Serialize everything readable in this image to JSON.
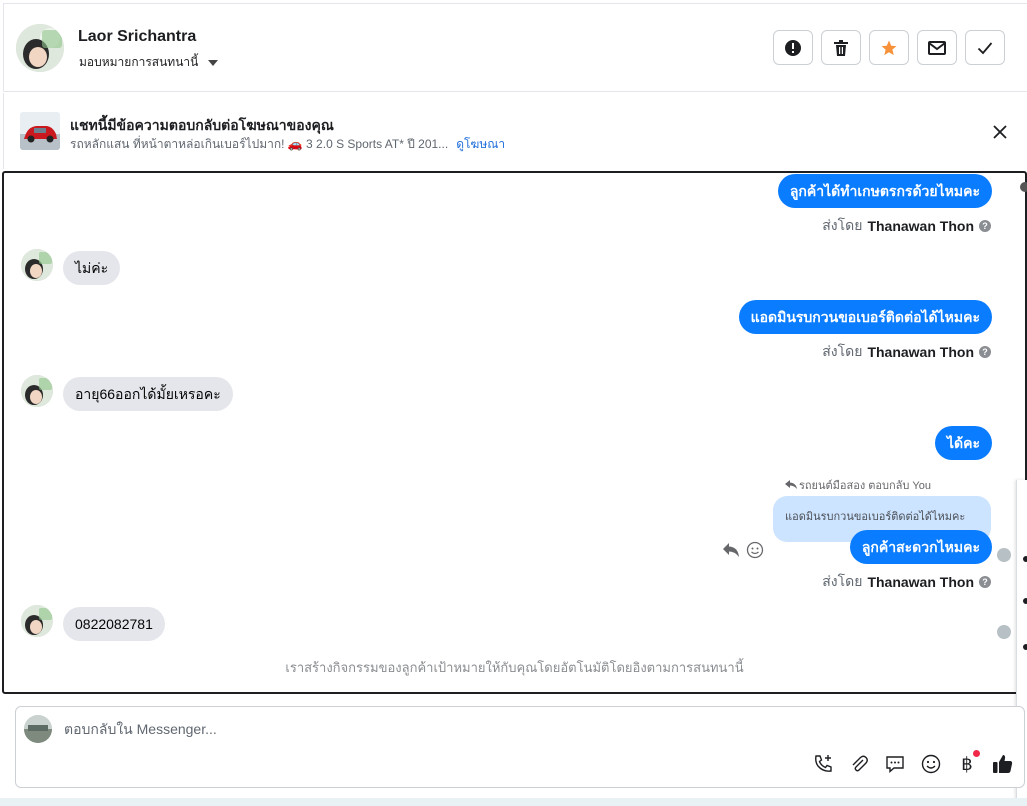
{
  "header": {
    "contact_name": "Laor Srichantra",
    "assign_label": "มอบหมายการสนทนานี้",
    "actions": [
      {
        "name": "report-button",
        "icon": "exclamation-icon"
      },
      {
        "name": "delete-button",
        "icon": "trash-icon"
      },
      {
        "name": "star-button",
        "icon": "star-icon"
      },
      {
        "name": "mark-unread-button",
        "icon": "envelope-icon"
      },
      {
        "name": "mark-done-button",
        "icon": "check-icon"
      }
    ],
    "star_color": "#f7923b"
  },
  "ad_banner": {
    "title": "แชทนี้มีข้อความตอบกลับต่อโฆษณาของคุณ",
    "subtitle": "รถหลักแสน ที่หน้าตาหล่อเกินเบอร์ไปมาก! 🚗 3 2.0 S Sports AT* ปี 201...",
    "link_label": "ดูโฆษณา"
  },
  "conversation": {
    "messages": [
      {
        "direction": "out",
        "text": "ลูกค้าได้ทำเกษตรกรด้วยไหมคะ",
        "sent_by_prefix": "ส่งโดย",
        "sent_by_name": "Thanawan Thon"
      },
      {
        "direction": "in",
        "text": "ไม่ค่ะ"
      },
      {
        "direction": "out",
        "text": "แอดมินรบกวนขอเบอร์ติดต่อได้ไหมคะ",
        "sent_by_prefix": "ส่งโดย",
        "sent_by_name": "Thanawan Thon"
      },
      {
        "direction": "in",
        "text": "อายุ66ออกได้มั้ยเหรอคะ"
      },
      {
        "direction": "out",
        "text": "ได้คะ"
      },
      {
        "direction": "out",
        "text": "ลูกค้าสะดวกไหมคะ",
        "reply_meta": "รถยนต์มือสอง ตอบกลับ You",
        "quoted": "แอดมินรบกวนขอเบอร์ติดต่อได้ไหมคะ",
        "sent_by_prefix": "ส่งโดย",
        "sent_by_name": "Thanawan Thon"
      },
      {
        "direction": "in",
        "text": "0822082781"
      }
    ],
    "automation_note": "เราสร้างกิจกรรมของลูกค้าเป้าหมายให้กับคุณโดยอัตโนมัติโดยอิงตามการสนทนานี้",
    "outgoing_color": "#0a7cff",
    "incoming_color": "#e4e6eb"
  },
  "composer": {
    "placeholder": "ตอบกลับใน Messenger...",
    "tools": [
      "call-add-icon",
      "paperclip-icon",
      "speech-bubble-icon",
      "emoji-icon",
      "baht-icon",
      "thumbs-up-icon"
    ],
    "baht_symbol": "฿"
  }
}
